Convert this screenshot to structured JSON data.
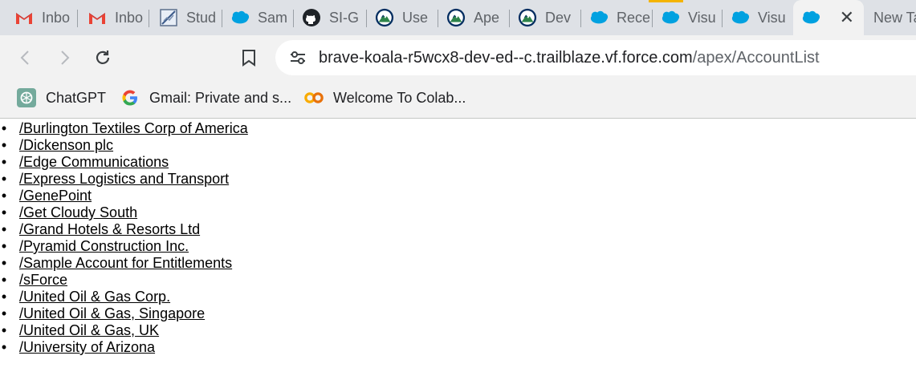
{
  "tabs": [
    {
      "label": "Inbo",
      "icon": "gmail-icon"
    },
    {
      "label": "Inbo",
      "icon": "gmail-icon"
    },
    {
      "label": "Stud",
      "icon": "studio-icon"
    },
    {
      "label": "Sam",
      "icon": "salesforce-cloud-icon"
    },
    {
      "label": "SI-G",
      "icon": "github-icon"
    },
    {
      "label": "Use",
      "icon": "trailhead-icon"
    },
    {
      "label": "Ape",
      "icon": "trailhead-icon"
    },
    {
      "label": "Dev",
      "icon": "trailhead-icon"
    },
    {
      "label": "Rece",
      "icon": "salesforce-cloud-icon"
    },
    {
      "label": "Visu",
      "icon": "salesforce-cloud-icon"
    },
    {
      "label": "Visu",
      "icon": "salesforce-cloud-icon"
    },
    {
      "label": "",
      "icon": "salesforce-cloud-icon",
      "active": true,
      "close": "✕"
    },
    {
      "label": "New Ta",
      "icon": ""
    }
  ],
  "toolbar": {
    "url_host": "brave-koala-r5wcx8-dev-ed--c.trailblaze.vf.force.com",
    "url_path": "/apex/AccountList"
  },
  "bookmarks": [
    {
      "label": "ChatGPT",
      "icon": "chatgpt-icon"
    },
    {
      "label": "Gmail: Private and s...",
      "icon": "google-icon"
    },
    {
      "label": "Welcome To Colab...",
      "icon": "colab-icon"
    }
  ],
  "accounts": [
    "/Burlington Textiles Corp of America",
    "/Dickenson plc",
    "/Edge Communications",
    "/Express Logistics and Transport",
    "/GenePoint",
    "/Get Cloudy South",
    "/Grand Hotels & Resorts Ltd",
    "/Pyramid Construction Inc.",
    "/Sample Account for Entitlements",
    "/sForce",
    "/United Oil & Gas Corp.",
    "/United Oil & Gas, Singapore",
    "/United Oil & Gas, UK",
    "/University of Arizona"
  ],
  "colors": {
    "tabstrip_bg": "#dee1e6",
    "toolbar_bg": "#f2f2f2",
    "salesforce_blue": "#00a1e0",
    "tab_accent": "#f4b400"
  }
}
